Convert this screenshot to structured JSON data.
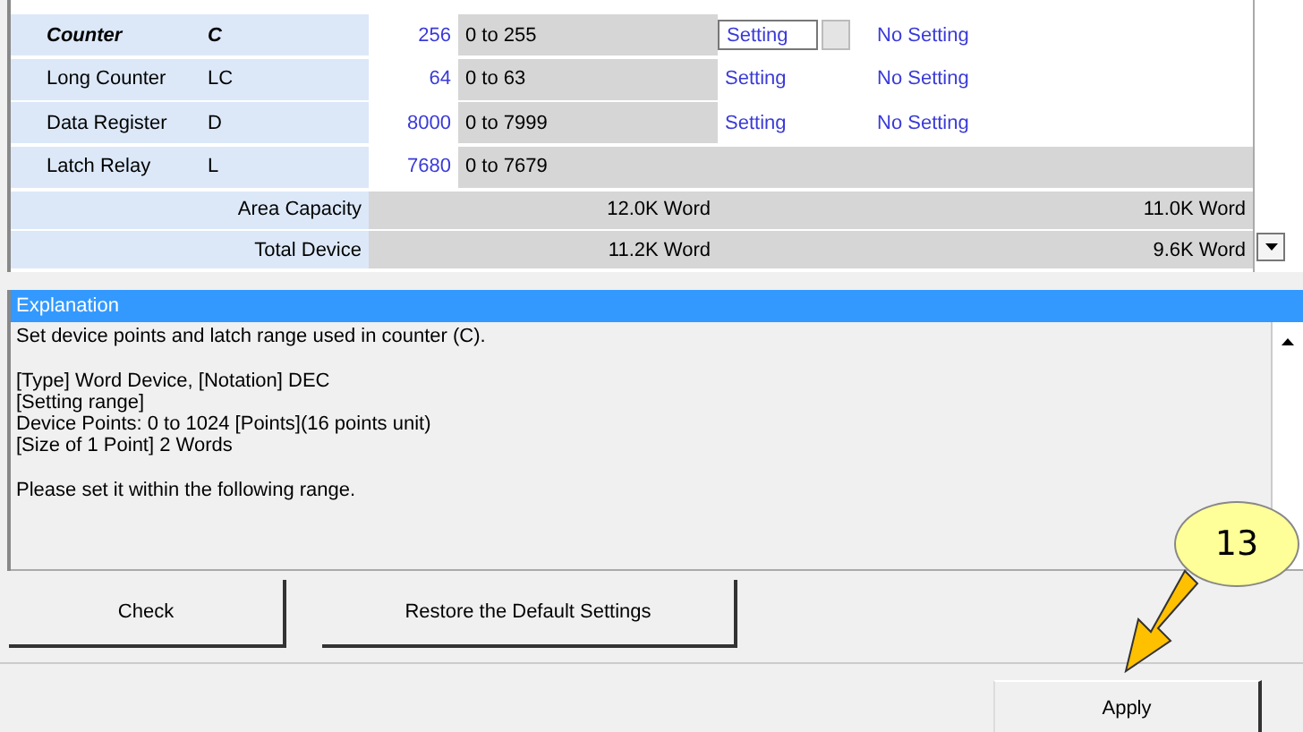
{
  "device_table": {
    "rows": [
      {
        "name": "Counter",
        "symbol": "C",
        "points": "256",
        "range": "0 to 255",
        "latch_1": "Setting",
        "latch_2": "No Setting",
        "selected": true
      },
      {
        "name": "Long Counter",
        "symbol": "LC",
        "points": "64",
        "range": "0 to 63",
        "latch_1": "Setting",
        "latch_2": "No Setting",
        "selected": false
      },
      {
        "name": "Data Register",
        "symbol": "D",
        "points": "8000",
        "range": "0 to 7999",
        "latch_1": "Setting",
        "latch_2": "No Setting",
        "selected": false
      },
      {
        "name": "Latch Relay",
        "symbol": "L",
        "points": "7680",
        "range": "0 to 7679",
        "selected": false
      }
    ],
    "summary": [
      {
        "label": "Area Capacity",
        "value_1": "12.0K Word",
        "value_2": "11.0K Word"
      },
      {
        "label": "Total Device",
        "value_1": "11.2K Word",
        "value_2": "9.6K Word"
      }
    ]
  },
  "explanation": {
    "title": "Explanation",
    "paragraphs": [
      [
        "Set device points and latch range used in counter (C)."
      ],
      [
        "[Type] Word Device, [Notation] DEC",
        "[Setting range]",
        "Device Points: 0 to 1024 [Points](16 points unit)",
        "[Size of 1 Point] 2 Words"
      ],
      [
        "Please set it within the following range."
      ]
    ]
  },
  "buttons": [
    "Check",
    "Restore the Default Settings"
  ],
  "apply_button": "Apply",
  "callout": {
    "label": "13"
  }
}
